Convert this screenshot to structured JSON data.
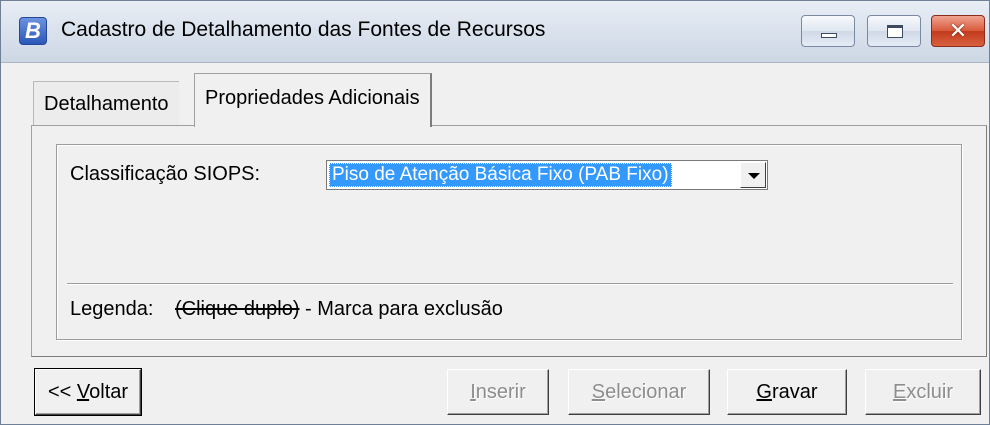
{
  "window": {
    "title": "Cadastro de Detalhamento das Fontes de Recursos",
    "app_icon_letter": "B"
  },
  "tabs": [
    {
      "label": "Detalhamento",
      "active": false
    },
    {
      "label": "Propriedades Adicionais",
      "active": true
    }
  ],
  "form": {
    "classificacao_label": "Classificação SIOPS:",
    "classificacao_value": "Piso de Atenção Básica Fixo (PAB Fixo)"
  },
  "legend": {
    "label": "Legenda:",
    "key": "(Clique duplo)",
    "text": "- Marca para exclusão"
  },
  "buttons": {
    "voltar": {
      "prefix": "<< ",
      "hotkey": "V",
      "rest": "oltar",
      "enabled": true
    },
    "inserir": {
      "hotkey": "I",
      "rest": "nserir",
      "enabled": false
    },
    "selecionar": {
      "hotkey": "S",
      "rest": "elecionar",
      "enabled": false
    },
    "gravar": {
      "hotkey": "G",
      "rest": "ravar",
      "enabled": true
    },
    "excluir": {
      "hotkey": "E",
      "rest": "xcluir",
      "enabled": false
    }
  },
  "colors": {
    "selection": "#3399ff",
    "close_button": "#c33a1c",
    "disabled_text": "#8d8d8d"
  }
}
